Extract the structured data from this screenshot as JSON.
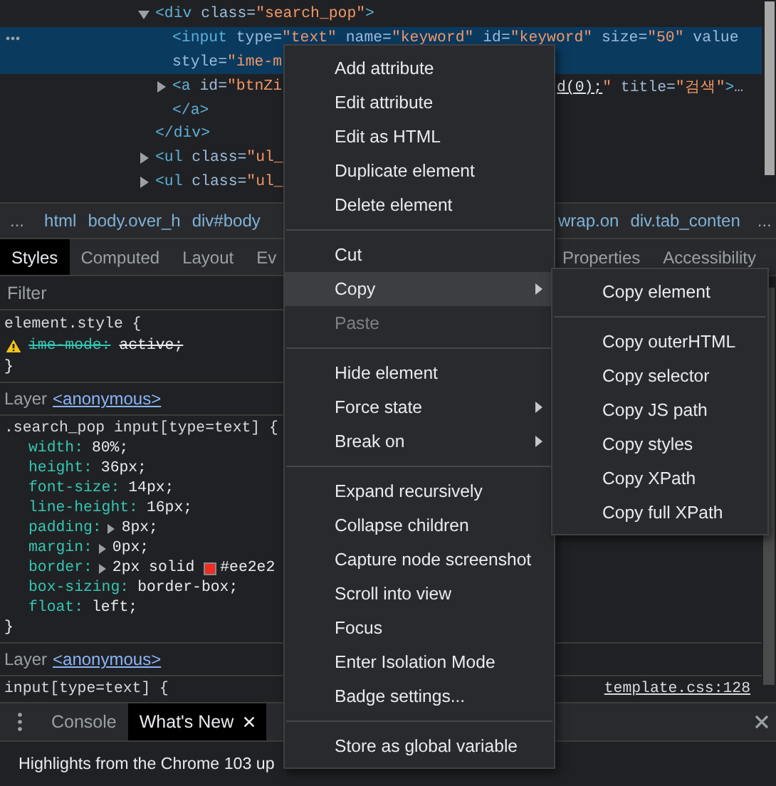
{
  "elements_tree": [
    {
      "kind": "parent",
      "expanded": true,
      "selected": false,
      "lines": [
        {
          "left": [
            {
              "kind": "tag",
              "text": "<div"
            },
            {
              "kind": "attr",
              "text": " class"
            },
            {
              "kind": "plain",
              "text": "="
            },
            {
              "kind": "value",
              "text": "\"search_pop\""
            },
            {
              "kind": "tag",
              "text": ">"
            }
          ]
        }
      ],
      "children": [
        {
          "kind": "leaf",
          "selected": true,
          "lines": [
            {
              "left": [
                {
                  "kind": "tag",
                  "text": "<input"
                },
                {
                  "kind": "attr",
                  "text": " type"
                },
                {
                  "kind": "plain",
                  "text": "="
                },
                {
                  "kind": "value",
                  "text": "\"text\""
                },
                {
                  "kind": "attr",
                  "text": " name"
                },
                {
                  "kind": "plain",
                  "text": "="
                },
                {
                  "kind": "value",
                  "text": "\"keyword\""
                },
                {
                  "kind": "attr",
                  "text": " id"
                },
                {
                  "kind": "plain",
                  "text": "="
                },
                {
                  "kind": "value",
                  "text": "\"keyword\""
                },
                {
                  "kind": "attr",
                  "text": " size"
                },
                {
                  "kind": "plain",
                  "text": "="
                },
                {
                  "kind": "value",
                  "text": "\"50\""
                },
                {
                  "kind": "attr",
                  "text": " value"
                }
              ]
            },
            {
              "left": [
                {
                  "kind": "attr",
                  "text": "style"
                },
                {
                  "kind": "plain",
                  "text": "="
                },
                {
                  "kind": "value",
                  "text": "\"ime-m"
                }
              ]
            }
          ]
        },
        {
          "kind": "parent",
          "expanded": false,
          "selected": false,
          "lines": [
            {
              "left": [
                {
                  "kind": "tag",
                  "text": "<a"
                },
                {
                  "kind": "attr",
                  "text": " id"
                },
                {
                  "kind": "plain",
                  "text": "="
                },
                {
                  "kind": "value",
                  "text": "\"btnZi"
                }
              ],
              "right": [
                {
                  "kind": "link",
                  "text": "d(0);"
                },
                {
                  "kind": "value",
                  "text": "\""
                },
                {
                  "kind": "attr",
                  "text": " title"
                },
                {
                  "kind": "plain",
                  "text": "="
                },
                {
                  "kind": "value",
                  "text": "\"검색\""
                },
                {
                  "kind": "tag",
                  "text": ">"
                },
                {
                  "kind": "plain",
                  "text": "…"
                }
              ]
            }
          ],
          "closing": {
            "left": [
              {
                "kind": "tag",
                "text": "</a>"
              }
            ]
          }
        }
      ],
      "closing": {
        "left": [
          {
            "kind": "tag",
            "text": "</div>"
          }
        ]
      }
    },
    {
      "kind": "parent",
      "expanded": false,
      "selected": false,
      "lines": [
        {
          "left": [
            {
              "kind": "tag",
              "text": "<ul"
            },
            {
              "kind": "attr",
              "text": " class"
            },
            {
              "kind": "plain",
              "text": "="
            },
            {
              "kind": "value",
              "text": "\"ul_"
            }
          ]
        }
      ]
    },
    {
      "kind": "parent",
      "expanded": false,
      "selected": false,
      "lines": [
        {
          "left": [
            {
              "kind": "tag",
              "text": "<ul"
            },
            {
              "kind": "attr",
              "text": " class"
            },
            {
              "kind": "plain",
              "text": "="
            },
            {
              "kind": "value",
              "text": "\"ul_"
            }
          ]
        }
      ]
    }
  ],
  "breadcrumbs": {
    "left": [
      {
        "kind": "overflow",
        "text": "..."
      },
      {
        "kind": "crumb",
        "text": "html"
      },
      {
        "kind": "crumb",
        "text": "body.over_h"
      },
      {
        "kind": "crumb",
        "text": "div#body"
      }
    ],
    "right": [
      {
        "kind": "crumb",
        "text": "wrap.on"
      },
      {
        "kind": "crumb",
        "text": "div.tab_conten"
      },
      {
        "kind": "overflow",
        "text": "..."
      }
    ]
  },
  "sidebar_tabs": {
    "left": [
      {
        "label": "Styles",
        "selected": true
      },
      {
        "label": "Computed",
        "selected": false
      },
      {
        "label": "Layout",
        "selected": false
      },
      {
        "label": "Ev",
        "selected": false
      }
    ],
    "right": [
      {
        "label": "Properties",
        "selected": false
      },
      {
        "label": "Accessibility",
        "selected": false
      }
    ]
  },
  "styles_pane": {
    "filter": {
      "placeholder": "Filter"
    },
    "sections": [
      {
        "kind": "rule",
        "selector": "element.style {",
        "declarations": [
          {
            "property": "ime-mode:",
            "value": "active;",
            "warning": true,
            "struck": true,
            "expandable": false
          }
        ],
        "closing": "}"
      },
      {
        "kind": "layer",
        "label": "Layer",
        "link": "<anonymous>"
      },
      {
        "kind": "rule",
        "selector": ".search_pop input[type=text] {",
        "declarations": [
          {
            "property": "width:",
            "value": "80%;",
            "warning": false,
            "struck": false,
            "expandable": false
          },
          {
            "property": "height:",
            "value": "36px;",
            "warning": false,
            "struck": false,
            "expandable": false
          },
          {
            "property": "font-size:",
            "value": "14px;",
            "warning": false,
            "struck": false,
            "expandable": false
          },
          {
            "property": "line-height:",
            "value": "16px;",
            "warning": false,
            "struck": false,
            "expandable": false
          },
          {
            "property": "padding:",
            "value": "8px;",
            "warning": false,
            "struck": false,
            "expandable": true
          },
          {
            "property": "margin:",
            "value": "0px;",
            "warning": false,
            "struck": false,
            "expandable": true
          },
          {
            "property": "border:",
            "value": "2px solid",
            "color": "#ee2e24",
            "swatch_text": "#ee2e2",
            "warning": false,
            "struck": false,
            "expandable": true
          },
          {
            "property": "box-sizing:",
            "value": "border-box;",
            "warning": false,
            "struck": false,
            "expandable": false
          },
          {
            "property": "float:",
            "value": "left;",
            "warning": false,
            "struck": false,
            "expandable": false
          }
        ],
        "closing": "}"
      },
      {
        "kind": "layer",
        "label": "Layer",
        "link": "<anonymous>"
      },
      {
        "kind": "rule",
        "selector": "input[type=text] {",
        "source": "template.css:128"
      }
    ]
  },
  "drawer": {
    "tabs": [
      {
        "label": "Console",
        "selected": false,
        "closable": false
      },
      {
        "label": "What's New",
        "selected": true,
        "closable": true
      }
    ],
    "message": "Highlights from the Chrome 103 up"
  },
  "context_menu": {
    "items": [
      {
        "kind": "item",
        "label": "Add attribute",
        "selected": false,
        "disabled": false,
        "submenu": false
      },
      {
        "kind": "item",
        "label": "Edit attribute",
        "selected": false,
        "disabled": false,
        "submenu": false
      },
      {
        "kind": "item",
        "label": "Edit as HTML",
        "selected": false,
        "disabled": false,
        "submenu": false
      },
      {
        "kind": "item",
        "label": "Duplicate element",
        "selected": false,
        "disabled": false,
        "submenu": false
      },
      {
        "kind": "item",
        "label": "Delete element",
        "selected": false,
        "disabled": false,
        "submenu": false
      },
      {
        "kind": "separator"
      },
      {
        "kind": "item",
        "label": "Cut",
        "selected": false,
        "disabled": false,
        "submenu": false
      },
      {
        "kind": "item",
        "label": "Copy",
        "selected": true,
        "disabled": false,
        "submenu": true
      },
      {
        "kind": "item",
        "label": "Paste",
        "selected": false,
        "disabled": true,
        "submenu": false
      },
      {
        "kind": "separator"
      },
      {
        "kind": "item",
        "label": "Hide element",
        "selected": false,
        "disabled": false,
        "submenu": false
      },
      {
        "kind": "item",
        "label": "Force state",
        "selected": false,
        "disabled": false,
        "submenu": true
      },
      {
        "kind": "item",
        "label": "Break on",
        "selected": false,
        "disabled": false,
        "submenu": true
      },
      {
        "kind": "separator"
      },
      {
        "kind": "item",
        "label": "Expand recursively",
        "selected": false,
        "disabled": false,
        "submenu": false
      },
      {
        "kind": "item",
        "label": "Collapse children",
        "selected": false,
        "disabled": false,
        "submenu": false
      },
      {
        "kind": "item",
        "label": "Capture node screenshot",
        "selected": false,
        "disabled": false,
        "submenu": false
      },
      {
        "kind": "item",
        "label": "Scroll into view",
        "selected": false,
        "disabled": false,
        "submenu": false
      },
      {
        "kind": "item",
        "label": "Focus",
        "selected": false,
        "disabled": false,
        "submenu": false
      },
      {
        "kind": "item",
        "label": "Enter Isolation Mode",
        "selected": false,
        "disabled": false,
        "submenu": false
      },
      {
        "kind": "item",
        "label": "Badge settings...",
        "selected": false,
        "disabled": false,
        "submenu": false
      },
      {
        "kind": "separator"
      },
      {
        "kind": "item",
        "label": "Store as global variable",
        "selected": false,
        "disabled": false,
        "submenu": false
      }
    ],
    "submenu": {
      "items": [
        {
          "kind": "item",
          "label": "Copy element"
        },
        {
          "kind": "separator"
        },
        {
          "kind": "item",
          "label": "Copy outerHTML"
        },
        {
          "kind": "item",
          "label": "Copy selector"
        },
        {
          "kind": "item",
          "label": "Copy JS path"
        },
        {
          "kind": "item",
          "label": "Copy styles"
        },
        {
          "kind": "item",
          "label": "Copy XPath"
        },
        {
          "kind": "item",
          "label": "Copy full XPath"
        }
      ]
    }
  }
}
